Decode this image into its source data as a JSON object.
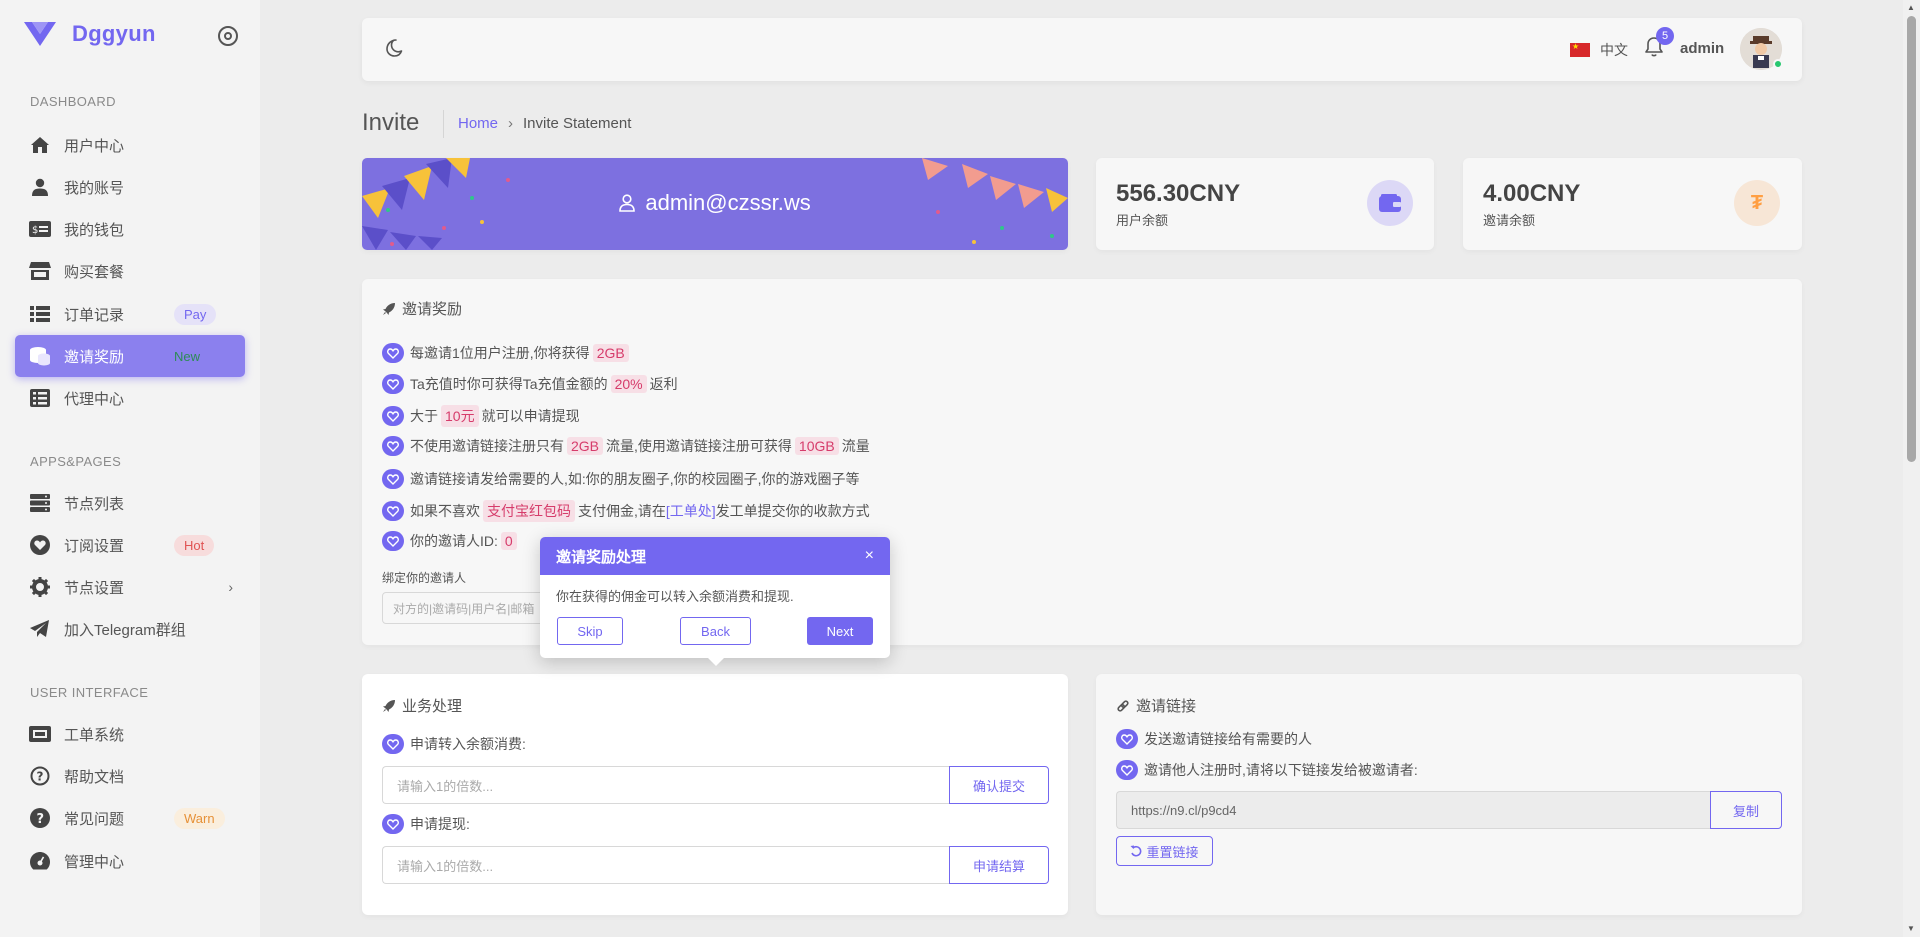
{
  "brand": {
    "name": "Dggyun"
  },
  "sidebar": {
    "sections": {
      "dashboard": "DASHBOARD",
      "apps": "APPS&PAGES",
      "ui": "USER INTERFACE"
    },
    "items": [
      {
        "label": "用户中心",
        "icon": "home-icon"
      },
      {
        "label": "我的账号",
        "icon": "user-icon"
      },
      {
        "label": "我的钱包",
        "icon": "wallet-icon"
      },
      {
        "label": "购买套餐",
        "icon": "store-icon"
      },
      {
        "label": "订单记录",
        "icon": "list-icon",
        "badge": "Pay"
      },
      {
        "label": "邀请奖励",
        "icon": "coins-icon",
        "badge": "New"
      },
      {
        "label": "代理中心",
        "icon": "list-alt-icon"
      },
      {
        "label": "节点列表",
        "icon": "server-icon"
      },
      {
        "label": "订阅设置",
        "icon": "heart-icon",
        "badge": "Hot"
      },
      {
        "label": "节点设置",
        "icon": "gear-icon"
      },
      {
        "label": "加入Telegram群组",
        "icon": "telegram-icon"
      },
      {
        "label": "工单系统",
        "icon": "ticket-icon"
      },
      {
        "label": "帮助文档",
        "icon": "question-icon"
      },
      {
        "label": "常见问题",
        "icon": "question-icon",
        "badge": "Warn"
      },
      {
        "label": "管理中心",
        "icon": "dashboard-icon"
      }
    ]
  },
  "navbar": {
    "language": "中文",
    "notifications": "5",
    "user": "admin"
  },
  "header": {
    "title": "Invite",
    "breadcrumb_home": "Home",
    "breadcrumb_current": "Invite Statement"
  },
  "banner": {
    "user_email": "admin@czssr.ws"
  },
  "stats": [
    {
      "value": "556.30CNY",
      "label": "用户余额",
      "color": "#7367f0"
    },
    {
      "value": "4.00CNY",
      "label": "邀请余额",
      "color": "#ff9f43"
    }
  ],
  "rewards": {
    "title": "邀请奖励",
    "rules": [
      {
        "pre": "每邀请1位用户注册,你将获得",
        "hl": "2GB",
        "post": ""
      },
      {
        "pre": "Ta充值时你可获得Ta充值金额的",
        "hl": "20%",
        "post": "返利"
      },
      {
        "pre": "大于",
        "hl": "10元",
        "post": "就可以申请提现"
      },
      {
        "pre": "不使用邀请链接注册只有",
        "hl": "2GB",
        "mid": "流量,使用邀请链接注册可获得",
        "hl2": "10GB",
        "post": "流量"
      },
      {
        "pre": "邀请链接请发给需要的人,如:你的朋友圈子,你的校园圈子,你的游戏圈子等"
      },
      {
        "pre": "如果不喜欢",
        "hl": "支付宝红包码",
        "mid": "支付佣金,请在",
        "link": "[工单处]",
        "post": "发工单提交你的收款方式"
      },
      {
        "pre": "你的邀请人ID:",
        "hl": "0",
        "post": ""
      }
    ],
    "bind_label": "绑定你的邀请人",
    "bind_placeholder": "对方的|邀请码|用户名|邮箱"
  },
  "business": {
    "title": "业务处理",
    "transfer_label": "申请转入余额消费:",
    "transfer_placeholder": "请输入1的倍数...",
    "transfer_button": "确认提交",
    "withdraw_label": "申请提现:",
    "withdraw_placeholder": "请输入1的倍数...",
    "withdraw_button": "申请结算"
  },
  "invite_link": {
    "title": "邀请链接",
    "line1": "发送邀请链接给有需要的人",
    "line2": "邀请他人注册时,请将以下链接发给被邀请者:",
    "url": "https://n9.cl/p9cd4",
    "copy_button": "复制",
    "reset_button": "重置链接"
  },
  "tour": {
    "title": "邀请奖励处理",
    "body": "你在获得的佣金可以转入余额消费和提现.",
    "skip": "Skip",
    "back": "Back",
    "next": "Next",
    "close": "×"
  }
}
